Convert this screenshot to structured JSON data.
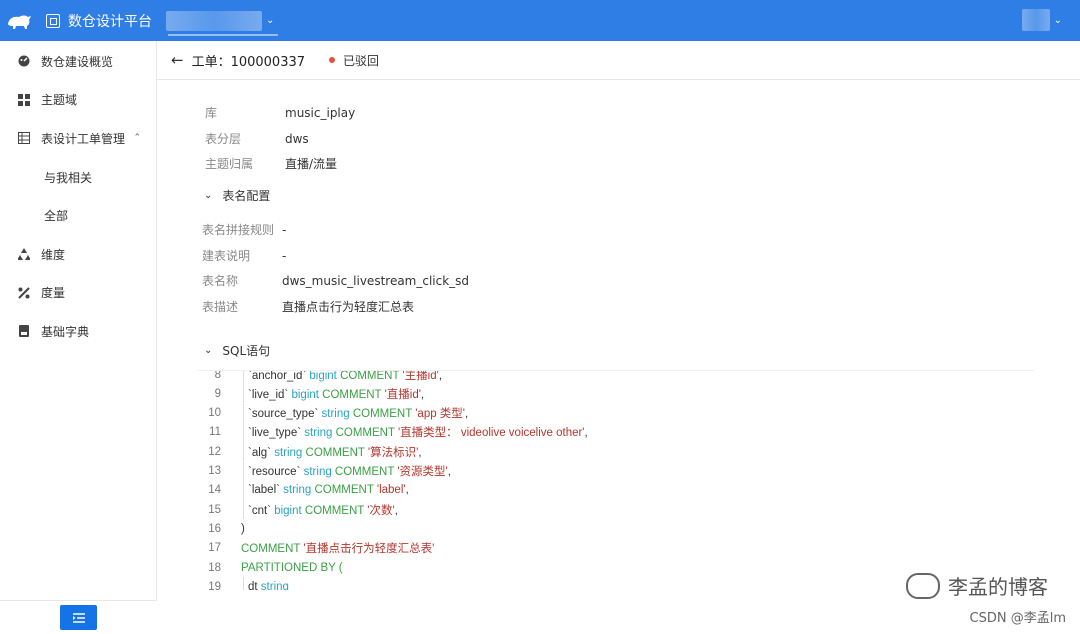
{
  "topbar": {
    "brand": "数仓设计平台",
    "colors": {
      "primary": "#2f7ee6"
    }
  },
  "sidebar": {
    "items": [
      {
        "label": "数仓建设概览",
        "icon": "dashboard-icon"
      },
      {
        "label": "主题域",
        "icon": "grid-icon"
      },
      {
        "label": "表设计工单管理",
        "icon": "table-icon",
        "expanded": true
      },
      {
        "label": "与我相关",
        "sub": true
      },
      {
        "label": "全部",
        "sub": true
      },
      {
        "label": "维度",
        "icon": "dimension-icon"
      },
      {
        "label": "度量",
        "icon": "measure-icon"
      },
      {
        "label": "基础字典",
        "icon": "dictionary-icon"
      }
    ],
    "collapse_icon": "menu-fold-icon"
  },
  "header": {
    "ticket": "工单：100000337",
    "status": "已驳回",
    "status_color": "#e55040"
  },
  "basic": {
    "db_label": "库",
    "db_value": "music_iplay",
    "layer_label": "表分层",
    "layer_value": "dws",
    "topic_label": "主题归属",
    "topic_value": "直播/流量"
  },
  "table_config": {
    "title": "表名配置",
    "rule_label": "表名拼接规则",
    "rule_value": "-",
    "desc_label": "建表说明",
    "desc_value": "-",
    "name_label": "表名称",
    "name_value": "dws_music_livestream_click_sd",
    "remark_label": "表描述",
    "remark_value": "直播点击行为轻度汇总表"
  },
  "sql": {
    "title": "SQL语句",
    "lines": [
      {
        "n": "8",
        "t": "`anchor_id` bigint COMMENT '主播id',",
        "id": "`anchor_id`",
        "type": "bigint",
        "str": "'主播id'"
      },
      {
        "n": "9",
        "id": "`live_id`",
        "type": "bigint",
        "str": "'直播id'"
      },
      {
        "n": "10",
        "id": "`source_type`",
        "type": "string",
        "str": "'app 类型'"
      },
      {
        "n": "11",
        "id": "`live_type`",
        "type": "string",
        "str": "'直播类型： videolive voicelive other'"
      },
      {
        "n": "12",
        "id": "`alg`",
        "type": "string",
        "str": "'算法标识'"
      },
      {
        "n": "13",
        "id": "`resource`",
        "type": "string",
        "str": "'资源类型'"
      },
      {
        "n": "14",
        "id": "`label`",
        "type": "string",
        "str": "'label'"
      },
      {
        "n": "15",
        "id": "`cnt`",
        "type": "bigint",
        "str": "'次数'"
      },
      {
        "n": "16",
        "plain": ")"
      },
      {
        "n": "17",
        "kw": "COMMENT",
        "str": "'直播点击行为轻度汇总表'"
      },
      {
        "n": "18",
        "kw": "PARTITIONED BY ("
      },
      {
        "n": "19",
        "id": "dt",
        "type": "string"
      }
    ],
    "comment_kw": "COMMENT"
  },
  "watermark": {
    "blog": "李孟的博客",
    "csdn": "CSDN @李孟lm"
  }
}
